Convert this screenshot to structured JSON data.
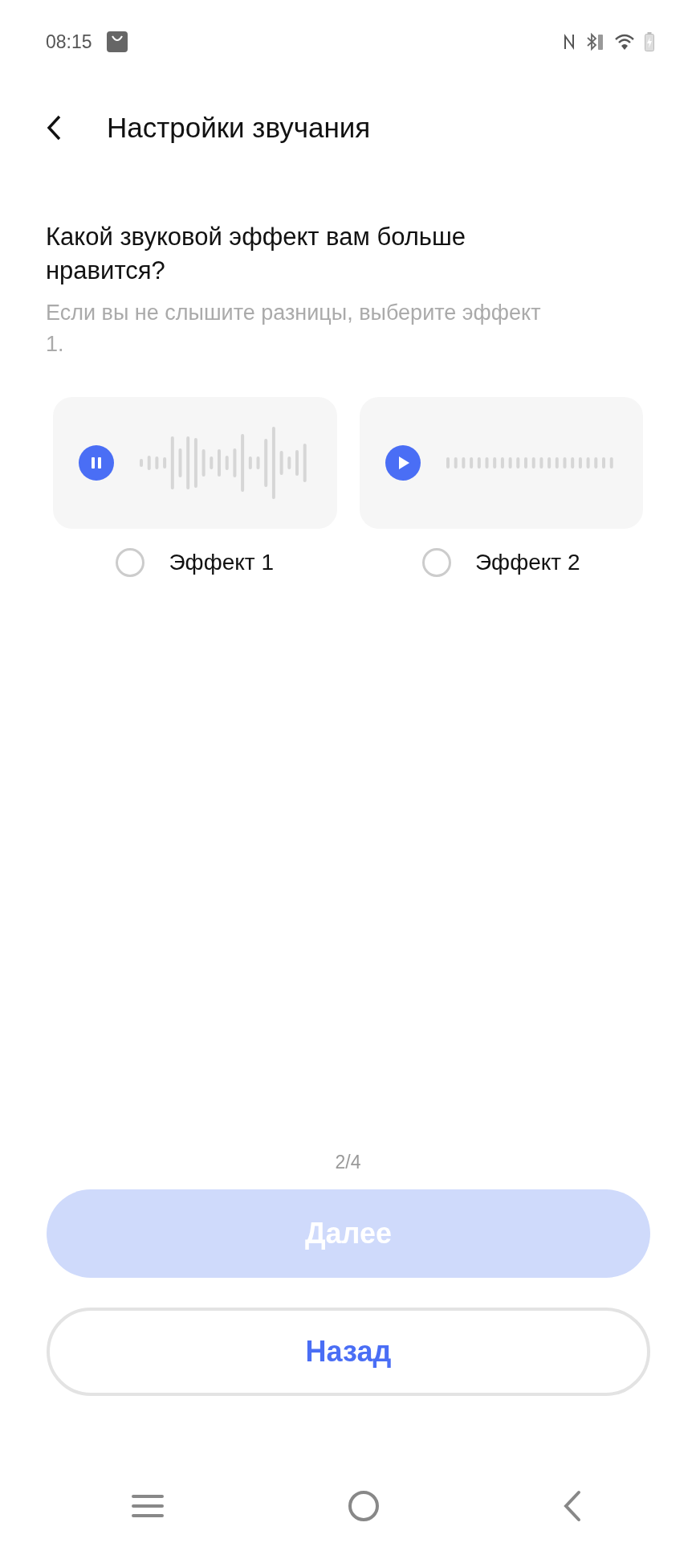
{
  "status_bar": {
    "time": "08:15"
  },
  "header": {
    "title": "Настройки звучания"
  },
  "question": "Какой звуковой эффект вам больше нравится?",
  "hint": "Если вы не слышите разницы, выберите эффект 1.",
  "effects": [
    {
      "label": "Эффект 1",
      "playing": true,
      "selected": false
    },
    {
      "label": "Эффект 2",
      "playing": false,
      "selected": false
    }
  ],
  "page_indicator": "2/4",
  "buttons": [
    {
      "label": "Далее",
      "kind": "primary",
      "disabled": true
    },
    {
      "label": "Назад",
      "kind": "outline",
      "disabled": false
    }
  ]
}
